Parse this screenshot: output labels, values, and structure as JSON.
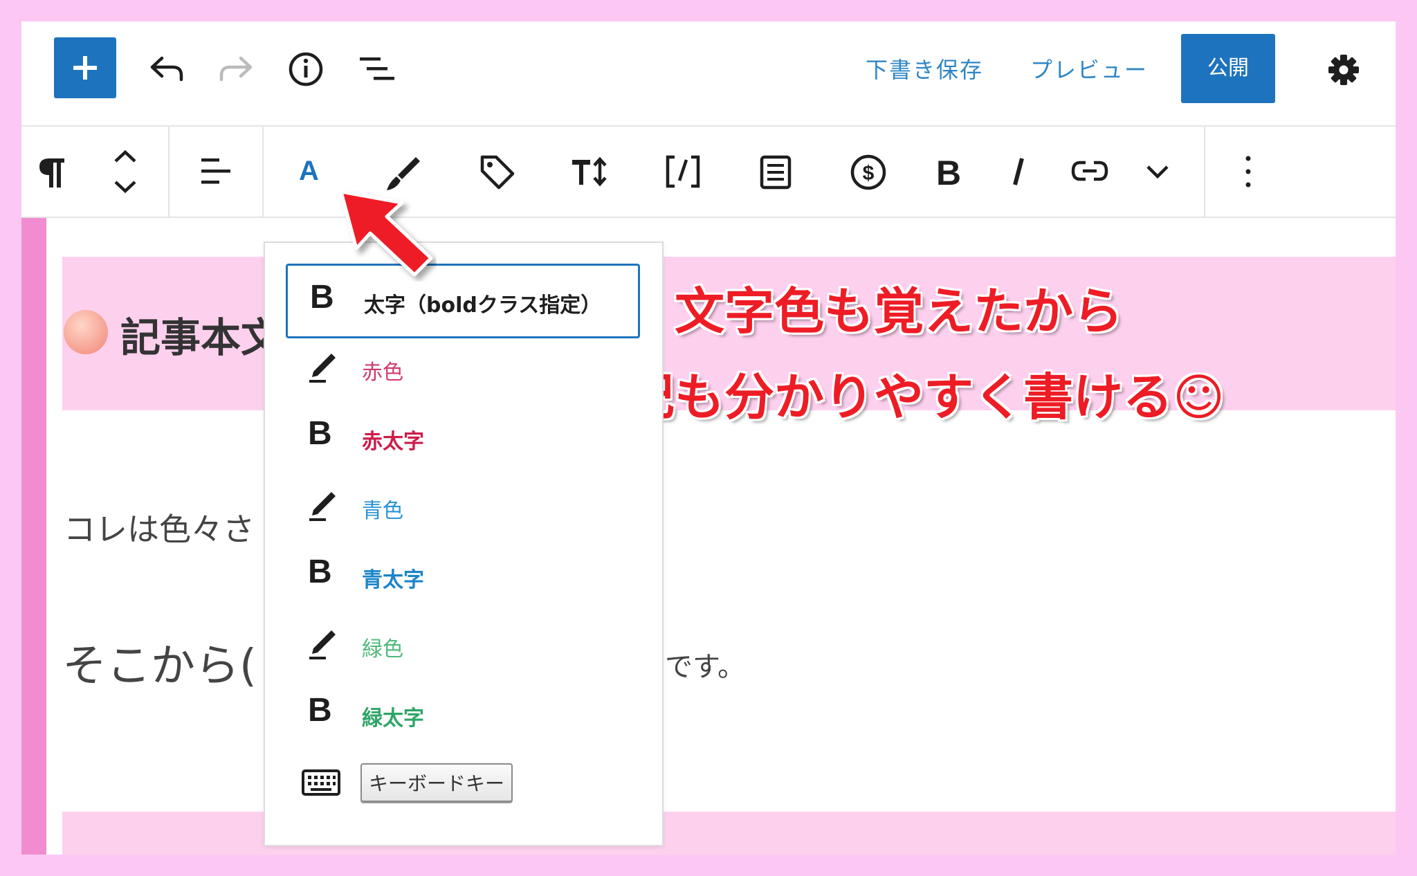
{
  "header": {
    "save_draft": "下書き保存",
    "preview": "プレビュー",
    "publish": "公開"
  },
  "icons": {
    "add": "plus-icon",
    "undo": "undo-icon",
    "redo": "redo-icon",
    "info": "info-icon",
    "outline": "list-view-icon",
    "settings": "gear-icon"
  },
  "block_toolbar": {
    "items": [
      "paragraph-icon",
      "move-arrows-icon",
      "align-icon",
      "text-color-icon",
      "highlighter-icon",
      "tag-icon",
      "font-size-icon",
      "shortcode-icon",
      "document-icon",
      "dollar-icon",
      "bold-icon",
      "italic-icon",
      "link-icon",
      "chevron-down-icon",
      "more-options-icon"
    ],
    "text_color_letter": "A"
  },
  "content": {
    "heading": "記事本文",
    "para1": "コレは色々さ",
    "para2": "そこから(",
    "para2_tail": "です。"
  },
  "annotation": {
    "line1": "文字色も覚えたから",
    "line2": "追記も分かりやすく書ける☺"
  },
  "dropdown": {
    "items": [
      {
        "icon": "bold",
        "label": "太字（boldクラス指定）",
        "color": "#1e1e1e",
        "bold": true
      },
      {
        "icon": "pen",
        "label": "赤色",
        "color": "#d23b6b",
        "bold": false
      },
      {
        "icon": "bold",
        "label": "赤太字",
        "color": "#cc1c4a",
        "bold": true
      },
      {
        "icon": "pen",
        "label": "青色",
        "color": "#2a93d5",
        "bold": false
      },
      {
        "icon": "bold",
        "label": "青太字",
        "color": "#1b84c9",
        "bold": true
      },
      {
        "icon": "pen",
        "label": "緑色",
        "color": "#4fb87a",
        "bold": false
      },
      {
        "icon": "bold",
        "label": "緑太字",
        "color": "#2ea566",
        "bold": true
      }
    ],
    "keyboard_key_label": "キーボードキー"
  },
  "colors": {
    "accent": "#1e73be",
    "page_background": "#fcc8f3",
    "annotation_red": "#ee1c25"
  }
}
